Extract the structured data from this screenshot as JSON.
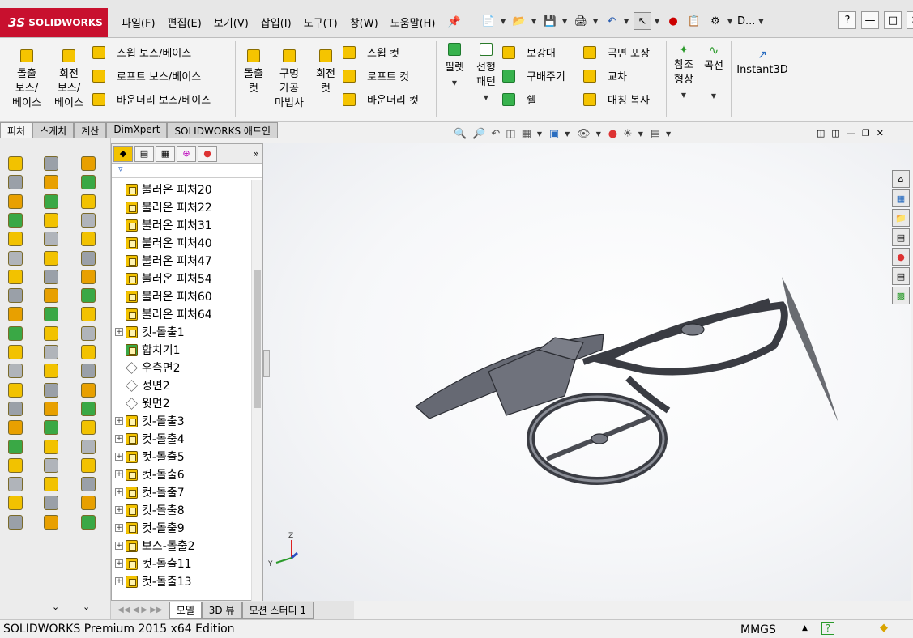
{
  "app": {
    "logo_text": "SOLIDWORKS",
    "logo_mark": "3S"
  },
  "menu": [
    "파일(F)",
    "편집(E)",
    "보기(V)",
    "삽입(I)",
    "도구(T)",
    "창(W)",
    "도움말(H)"
  ],
  "window": {
    "title_short": "D..."
  },
  "ribbon": {
    "extrude_boss": "돌출\n보스/\n베이스",
    "revolve_boss": "회전\n보스/\n베이스",
    "sweep_boss": "스윕 보스/베이스",
    "loft_boss": "로프트 보스/베이스",
    "boundary_boss": "바운더리 보스/베이스",
    "extrude_cut": "돌출\n컷",
    "hole_wizard": "구멍\n가공\n마법사",
    "revolve_cut": "회전\n컷",
    "sweep_cut": "스윕 컷",
    "loft_cut": "로프트 컷",
    "boundary_cut": "바운더리 컷",
    "fillet": "필렛",
    "linear_pattern": "선형\n패턴",
    "rib": "보강대",
    "draft": "구배주기",
    "shell": "쉘",
    "wrap": "곡면 포장",
    "intersect": "교차",
    "mirror": "대칭 복사",
    "ref_geometry": "참조\n형상",
    "curves": "곡선",
    "instant3d": "Instant3D"
  },
  "tabs": [
    "피처",
    "스케치",
    "계산",
    "DimXpert",
    "SOLIDWORKS 애드인"
  ],
  "tree": {
    "items": [
      {
        "label": "불러온 피처20",
        "kind": "feature",
        "expand": false
      },
      {
        "label": "불러온 피처22",
        "kind": "feature",
        "expand": false
      },
      {
        "label": "불러온 피처31",
        "kind": "feature",
        "expand": false
      },
      {
        "label": "불러온 피처40",
        "kind": "feature",
        "expand": false
      },
      {
        "label": "불러온 피처47",
        "kind": "feature",
        "expand": false
      },
      {
        "label": "불러온 피처54",
        "kind": "feature",
        "expand": false
      },
      {
        "label": "불러온 피처60",
        "kind": "feature",
        "expand": false
      },
      {
        "label": "불러온 피처64",
        "kind": "feature",
        "expand": false
      },
      {
        "label": "컷-돌출1",
        "kind": "feature",
        "expand": true
      },
      {
        "label": "합치기1",
        "kind": "combine",
        "expand": false
      },
      {
        "label": "우측면2",
        "kind": "plane",
        "expand": false
      },
      {
        "label": "정면2",
        "kind": "plane",
        "expand": false
      },
      {
        "label": "윗면2",
        "kind": "plane",
        "expand": false
      },
      {
        "label": "컷-돌출3",
        "kind": "feature",
        "expand": true
      },
      {
        "label": "컷-돌출4",
        "kind": "feature",
        "expand": true
      },
      {
        "label": "컷-돌출5",
        "kind": "feature",
        "expand": true
      },
      {
        "label": "컷-돌출6",
        "kind": "feature",
        "expand": true
      },
      {
        "label": "컷-돌출7",
        "kind": "feature",
        "expand": true
      },
      {
        "label": "컷-돌출8",
        "kind": "feature",
        "expand": true
      },
      {
        "label": "컷-돌출9",
        "kind": "feature",
        "expand": true
      },
      {
        "label": "보스-돌출2",
        "kind": "feature",
        "expand": true
      },
      {
        "label": "컷-돌출11",
        "kind": "feature",
        "expand": true
      },
      {
        "label": "컷-돌출13",
        "kind": "feature",
        "expand": true
      }
    ]
  },
  "bottom_tabs": [
    "모델",
    "3D 뷰",
    "모션 스터디 1"
  ],
  "status": {
    "edition": "SOLIDWORKS Premium 2015 x64 Edition",
    "units": "MMGS",
    "help": "?"
  },
  "axes": {
    "z": "Z",
    "y": "Y"
  },
  "colors": {
    "brand_red": "#c8102e",
    "feature_yellow": "#f2c200",
    "model_gray": "#5a5d66"
  }
}
